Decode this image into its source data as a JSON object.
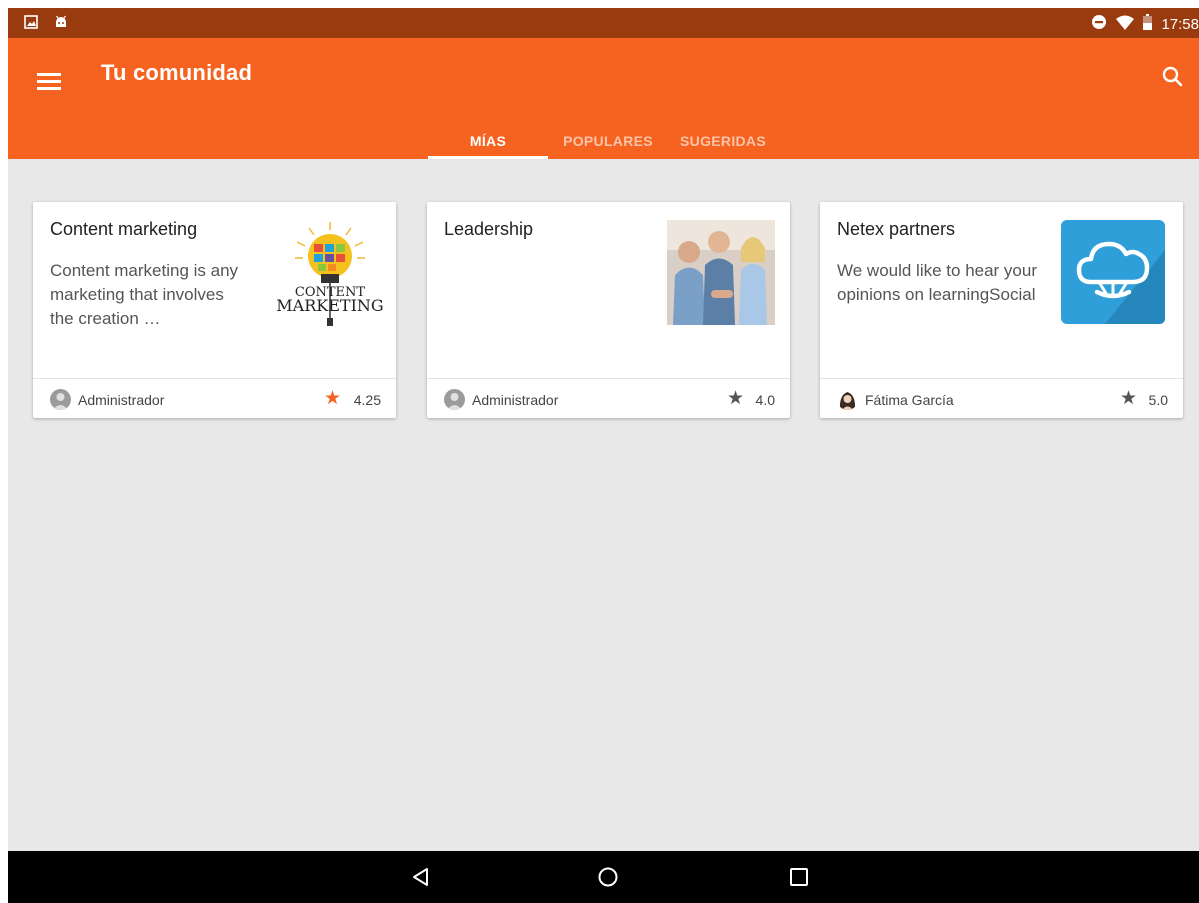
{
  "status_bar": {
    "left_icons": [
      "image-icon",
      "android-icon"
    ],
    "right_icons": [
      "do-not-disturb-icon",
      "wifi-icon",
      "battery-icon"
    ],
    "time": "17:58"
  },
  "app_bar": {
    "title": "Tu comunidad",
    "menu_icon": "hamburger-menu-icon",
    "search_icon": "search-icon",
    "color": "#f6621f"
  },
  "tabs": [
    {
      "label": "MÍAS",
      "active": true
    },
    {
      "label": "POPULARES",
      "active": false
    },
    {
      "label": "SUGERIDAS",
      "active": false
    }
  ],
  "cards": [
    {
      "title": "Content marketing",
      "description": "Content marketing is any marketing that involves the creation …",
      "image": {
        "type": "lightbulb-illustration",
        "text": [
          "CONTENT",
          "MARKETING"
        ]
      },
      "author": "Administrador",
      "rating": "4.25",
      "star_color": "#f6621f"
    },
    {
      "title": "Leadership",
      "description": "",
      "image": {
        "type": "people-photo"
      },
      "author": "Administrador",
      "rating": "4.0",
      "star_color": "#555555"
    },
    {
      "title": "Netex partners",
      "description": "We would like to hear your opinions on learningSocial",
      "image": {
        "type": "cloud-logo",
        "color": "#2e9fd8"
      },
      "author": "Fátima García",
      "rating": "5.0",
      "star_color": "#555555"
    }
  ],
  "nav_bar": {
    "buttons": [
      "back-icon",
      "home-icon",
      "recents-icon"
    ]
  }
}
